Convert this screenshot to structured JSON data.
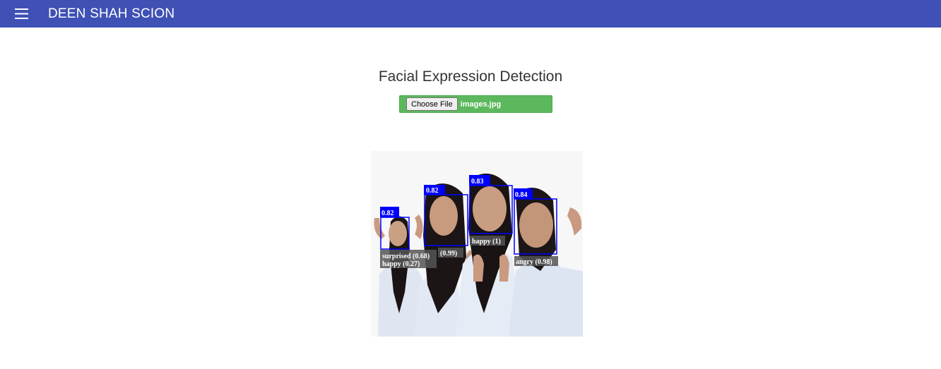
{
  "header": {
    "menu_icon": "hamburger-menu-icon",
    "brand": "DEEN SHAH SCION",
    "bar_color": "#3f51b5"
  },
  "main": {
    "title": "Facial Expression Detection",
    "upload": {
      "button_label": "Choose File",
      "file_name": "images.jpg",
      "bar_color": "#5cb85c"
    }
  },
  "result": {
    "box_color": "#0000ff",
    "faces": [
      {
        "score": "0.82",
        "labels": [
          "surprised (0.68)",
          "happy (0.27)"
        ]
      },
      {
        "score": "0.82",
        "labels": [
          "(0.99)"
        ]
      },
      {
        "score": "0.83",
        "labels": [
          "happy (1)"
        ]
      },
      {
        "score": "0.84",
        "labels": [
          "angry (0.98)"
        ]
      }
    ]
  }
}
